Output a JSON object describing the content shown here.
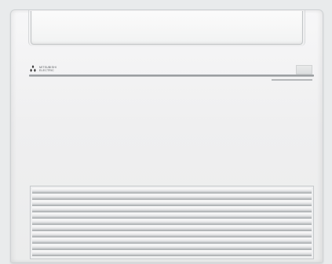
{
  "product": {
    "type": "floor-standing air conditioner indoor unit",
    "brand_lines": [
      "MITSUBISHI",
      "ELECTRIC"
    ],
    "body_color": "#efeff0",
    "background_color": "#e9ebec",
    "grille_slat_count": 11
  }
}
